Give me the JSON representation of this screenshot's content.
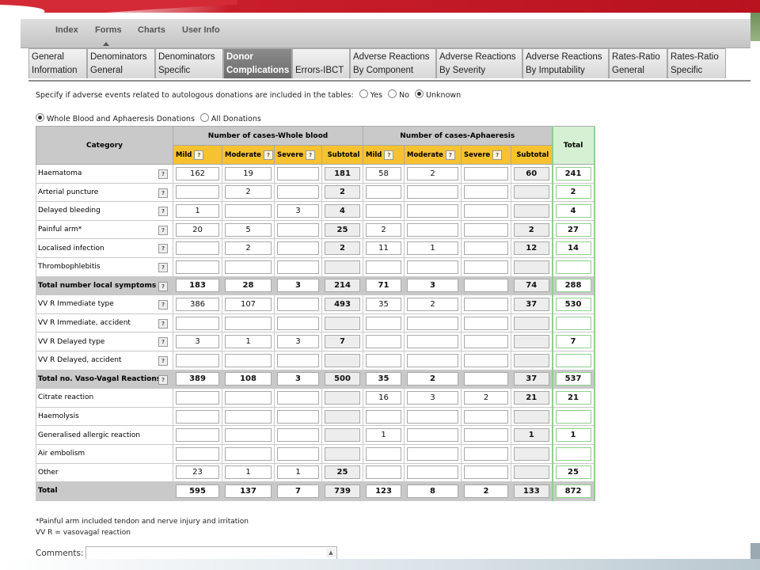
{
  "nav": {
    "items": [
      "Index",
      "Forms",
      "Charts",
      "User Info"
    ],
    "active": "Forms"
  },
  "tabs": [
    {
      "line1": "General",
      "line2": "Information",
      "active": false
    },
    {
      "line1": "Denominators",
      "line2": "General",
      "active": false
    },
    {
      "line1": "Denominators",
      "line2": "Specific",
      "active": false
    },
    {
      "line1": "Donor",
      "line2": "Complications",
      "active": true
    },
    {
      "line1": "Errors-IBCT",
      "line2": "",
      "active": false
    },
    {
      "line1": "Adverse Reactions",
      "line2": "By Component",
      "active": false
    },
    {
      "line1": "Adverse Reactions",
      "line2": "By Severity",
      "active": false
    },
    {
      "line1": "Adverse Reactions",
      "line2": "By Imputability",
      "active": false
    },
    {
      "line1": "Rates-Ratio",
      "line2": "General",
      "active": false
    },
    {
      "line1": "Rates-Ratio",
      "line2": "Specific",
      "active": false
    }
  ],
  "autologous": {
    "question": "Specify if adverse events related to autologous donations are included in the tables:",
    "options": [
      "Yes",
      "No",
      "Unknown"
    ],
    "selected": "Unknown"
  },
  "donation_type": {
    "options": [
      "Whole Blood and Aphaeresis Donations",
      "All Donations"
    ],
    "selected": "Whole Blood and Aphaeresis Donations"
  },
  "table": {
    "category_header": "Category",
    "whole_blood_header": "Number of cases-Whole blood",
    "aphaeresis_header": "Number of cases-Aphaeresis",
    "total_header": "Total",
    "sub_headers": [
      "Mild",
      "Moderate",
      "Severe",
      "Subtotal"
    ],
    "help_glyph": "?",
    "rows": [
      {
        "name": "Haematoma",
        "bold": false,
        "wb": [
          "162",
          "19",
          "",
          "181"
        ],
        "ap": [
          "58",
          "2",
          "",
          "60"
        ],
        "total": "241"
      },
      {
        "name": "Arterial puncture",
        "bold": false,
        "wb": [
          "",
          "2",
          "",
          "2"
        ],
        "ap": [
          "",
          "",
          "",
          ""
        ],
        "total": "2"
      },
      {
        "name": "Delayed bleeding",
        "bold": false,
        "wb": [
          "1",
          "",
          "3",
          "4"
        ],
        "ap": [
          "",
          "",
          "",
          ""
        ],
        "total": "4"
      },
      {
        "name": "Painful arm*",
        "bold": false,
        "wb": [
          "20",
          "5",
          "",
          "25"
        ],
        "ap": [
          "2",
          "",
          "",
          "2"
        ],
        "total": "27"
      },
      {
        "name": "Localised infection",
        "bold": false,
        "wb": [
          "",
          "2",
          "",
          "2"
        ],
        "ap": [
          "11",
          "1",
          "",
          "12"
        ],
        "total": "14"
      },
      {
        "name": "Thrombophlebitis",
        "bold": false,
        "wb": [
          "",
          "",
          "",
          ""
        ],
        "ap": [
          "",
          "",
          "",
          ""
        ],
        "total": ""
      },
      {
        "name": "Total number local symptoms",
        "bold": true,
        "wb": [
          "183",
          "28",
          "3",
          "214"
        ],
        "ap": [
          "71",
          "3",
          "",
          "74"
        ],
        "total": "288"
      },
      {
        "name": "VV R Immediate type",
        "bold": false,
        "wb": [
          "386",
          "107",
          "",
          "493"
        ],
        "ap": [
          "35",
          "2",
          "",
          "37"
        ],
        "total": "530"
      },
      {
        "name": "VV R Immediate, accident",
        "bold": false,
        "wb": [
          "",
          "",
          "",
          ""
        ],
        "ap": [
          "",
          "",
          "",
          ""
        ],
        "total": ""
      },
      {
        "name": "VV R Delayed type",
        "bold": false,
        "wb": [
          "3",
          "1",
          "3",
          "7"
        ],
        "ap": [
          "",
          "",
          "",
          ""
        ],
        "total": "7"
      },
      {
        "name": "VV R Delayed, accident",
        "bold": false,
        "wb": [
          "",
          "",
          "",
          ""
        ],
        "ap": [
          "",
          "",
          "",
          ""
        ],
        "total": ""
      },
      {
        "name": "Total no. Vaso-Vagal Reactions",
        "bold": true,
        "wb": [
          "389",
          "108",
          "3",
          "500"
        ],
        "ap": [
          "35",
          "2",
          "",
          "37"
        ],
        "total": "537"
      },
      {
        "name": "Citrate reaction",
        "bold": false,
        "nohelp": true,
        "wb": [
          "",
          "",
          "",
          ""
        ],
        "ap": [
          "16",
          "3",
          "2",
          "21"
        ],
        "total": "21"
      },
      {
        "name": "Haemolysis",
        "bold": false,
        "nohelp": true,
        "wb": [
          "",
          "",
          "",
          ""
        ],
        "ap": [
          "",
          "",
          "",
          ""
        ],
        "total": ""
      },
      {
        "name": "Generalised allergic reaction",
        "bold": false,
        "nohelp": true,
        "wb": [
          "",
          "",
          "",
          ""
        ],
        "ap": [
          "1",
          "",
          "",
          "1"
        ],
        "total": "1"
      },
      {
        "name": "Air embolism",
        "bold": false,
        "nohelp": true,
        "wb": [
          "",
          "",
          "",
          ""
        ],
        "ap": [
          "",
          "",
          "",
          ""
        ],
        "total": ""
      },
      {
        "name": "Other",
        "bold": false,
        "nohelp": true,
        "wb": [
          "23",
          "1",
          "1",
          "25"
        ],
        "ap": [
          "",
          "",
          "",
          ""
        ],
        "total": "25"
      },
      {
        "name": "Total",
        "bold": true,
        "nohelp": true,
        "wb": [
          "595",
          "137",
          "7",
          "739"
        ],
        "ap": [
          "123",
          "8",
          "2",
          "133"
        ],
        "total": "872"
      }
    ]
  },
  "footnotes": [
    "*Painful arm included tendon and nerve injury and irritation",
    "VV R = vasovagal reaction"
  ],
  "comments": {
    "label": "Comments:",
    "value": ""
  }
}
